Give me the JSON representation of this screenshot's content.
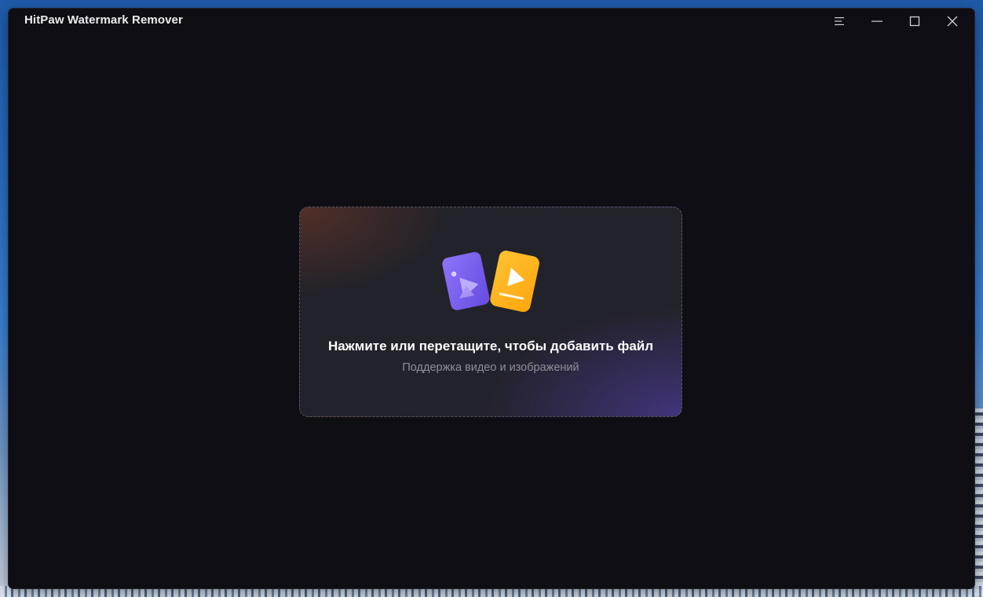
{
  "window": {
    "title": "HitPaw Watermark Remover",
    "controls": [
      "menu-icon",
      "minimize-icon",
      "maximize-icon",
      "close-icon"
    ]
  },
  "dropzone": {
    "title": "Нажмите или перетащите, чтобы добавить файл",
    "subtitle": "Поддержка видео и изображений",
    "icon": "image-video-files-icon"
  },
  "colors": {
    "window_bg": "#0e0e14",
    "image_card": "#7b5cf0",
    "video_card": "#ffb31a"
  }
}
